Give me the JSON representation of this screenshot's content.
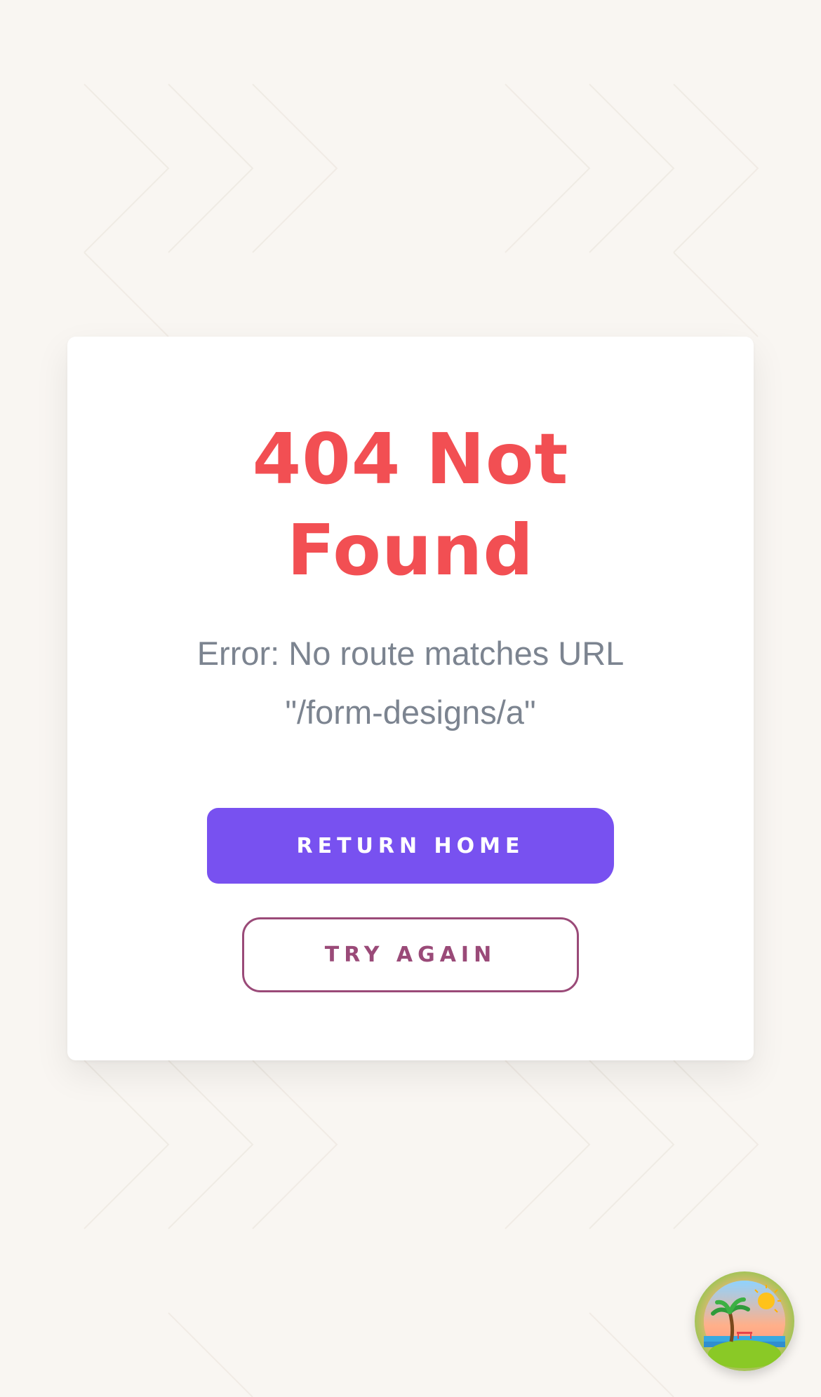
{
  "error_card": {
    "title_line1": "404 Not",
    "title_line2": "Found",
    "message_line1": "Error: No route matches URL",
    "message_line2": "\"/form-designs/a\""
  },
  "buttons": {
    "return_home": "Return Home",
    "try_again": "Try Again"
  },
  "colors": {
    "background": "#f9f6f2",
    "title": "#f24f53",
    "message": "#7c8490",
    "primary_button": "#7851f0",
    "secondary_button": "#9a4a78"
  },
  "fab": {
    "icon": "tropical-island-icon"
  }
}
